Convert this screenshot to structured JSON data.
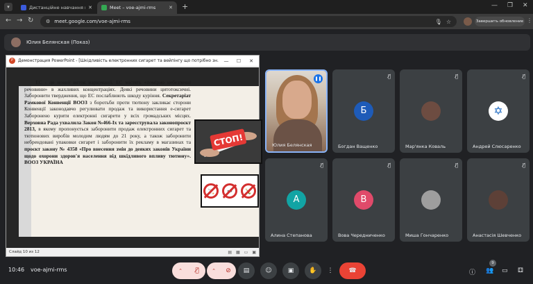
{
  "browser": {
    "tabs": [
      {
        "title": "Дистанційне навчання в ВСП",
        "favicon_color": "#3b5bdb"
      },
      {
        "title": "Meet – voe-ajmi-rms",
        "favicon_color": "#34a853"
      }
    ],
    "new_tab_icon": "plus-icon",
    "url": "meet.google.com/voe-ajmi-rms",
    "update_button": "Завершить обновление"
  },
  "presenter": {
    "label": "Юлия Белянская (Показ)"
  },
  "ppt": {
    "window_title": "Демонстрация PowerPoint - [Шкідливість електронних сигарет та вейпінгу що потрібно зн...",
    "status": "Слайд 10 из 12",
    "slide": {
      "p1": "ЕС - це новий виток наркоманії. ЕС містять «помірно небезпечні речовини» в жахливих концентраціях. Деякі речовини цитотоксичні. Заборонити твердження, що ЕС послаблюють шкоду куріння.",
      "b1": "Секретаріат Рамкової Конвенції ВООЗ",
      "p2": "з боротьби проти тютюну закликає сторони Конвенції законодавчо регулювати продаж та використання е-сигарет Заборонено курити електронні сигарети у всіх громадських місцях.",
      "b2": "Верховна Рада ухвалила Закон №466-Іх та зареєструвала законопроєкт 2813,",
      "p3": "в якому пропонується заборонити продаж електронних сигарет та тютюнових виробів молодим людям до 21 року, а також заборонити небрендовані упаковки сигарет і заборонити їх рекламу в магазинах та",
      "b3": "проєкт закону № 4358 «Про внесення змін до деяких законів України щодо охорони здоров'я населення від шкідливого впливу тютюну». ВООЗ УКРАЇНА",
      "img1_text": "СТОП!"
    }
  },
  "participants": [
    {
      "name": "Юлия Белянская",
      "type": "video"
    },
    {
      "name": "Богдан Ващенко",
      "initial": "Б",
      "color": "#1e5bb8"
    },
    {
      "name": "Мар'янка Коваль",
      "type": "photo",
      "color": "#6d4c41"
    },
    {
      "name": "Андрей Слюсаренко",
      "type": "photo",
      "color": "#e8eaed"
    },
    {
      "name": "Алина Степанова",
      "initial": "А",
      "color": "#12a4a4"
    },
    {
      "name": "Вова Чередниченко",
      "initial": "В",
      "color": "#e04a6a"
    },
    {
      "name": "Миша Гончаренко",
      "type": "photo",
      "color": "#9e9e9e"
    },
    {
      "name": "Анастасія Шевченко",
      "type": "photo",
      "color": "#5d4037"
    }
  ],
  "bottom": {
    "time": "10:46",
    "meeting_code": "voe-ajmi-rms",
    "participants_count": "9"
  }
}
